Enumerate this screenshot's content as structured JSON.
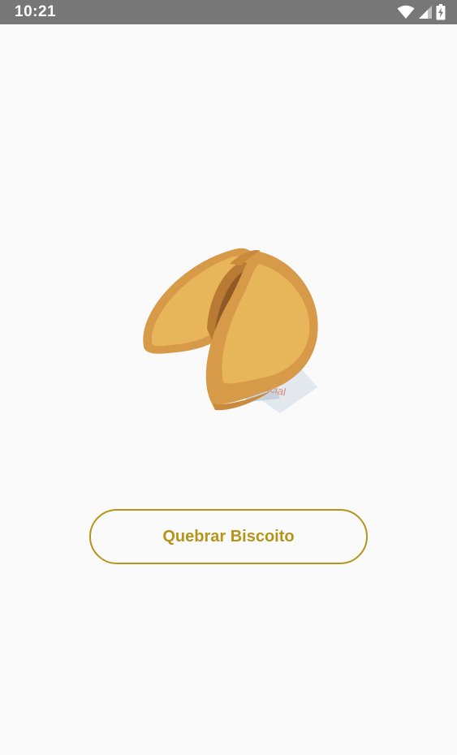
{
  "status_bar": {
    "time": "10:21",
    "icons": [
      "wifi-icon",
      "signal-icon",
      "battery-charging-icon"
    ]
  },
  "main": {
    "image": {
      "icon": "fortune-cookie-icon",
      "paper_text": "ecial"
    },
    "button": {
      "label": "Quebrar Biscoito"
    }
  },
  "colors": {
    "status_bar": "#777777",
    "background": "#fafafa",
    "accent": "#b59519",
    "cookie_light": "#e8b65a",
    "cookie_dark": "#c98a3c"
  }
}
